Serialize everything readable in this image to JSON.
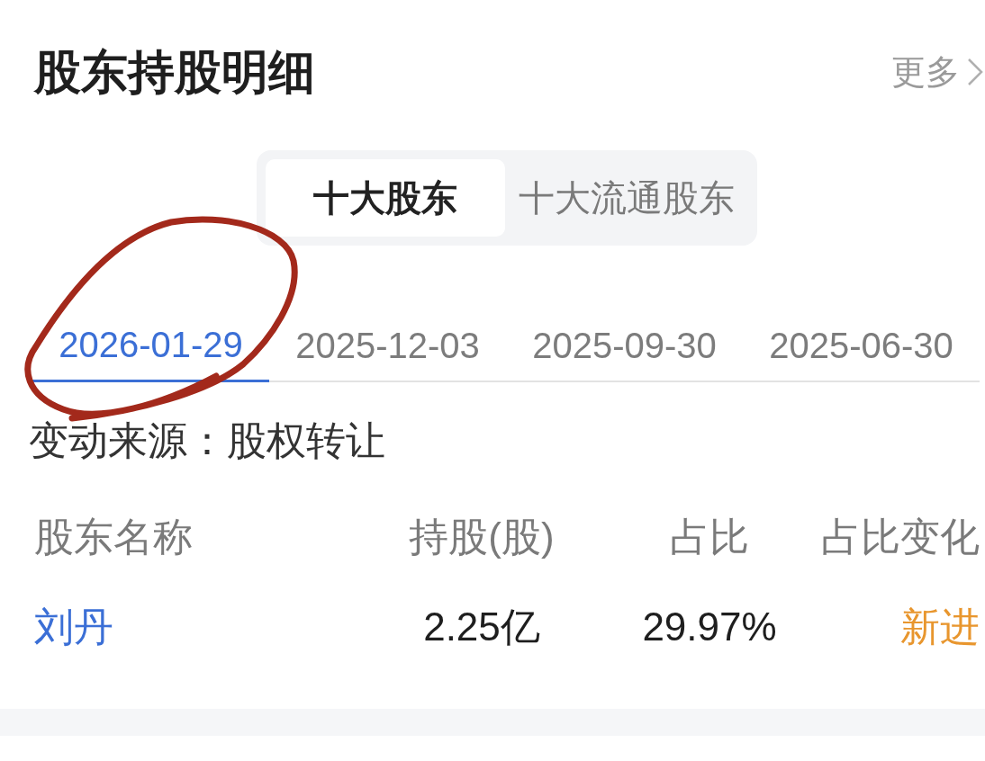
{
  "header": {
    "title": "股东持股明细",
    "more_link": "更多"
  },
  "segments": [
    {
      "label": "十大股东",
      "selected": true
    },
    {
      "label": "十大流通股东",
      "selected": false
    }
  ],
  "date_tabs": [
    {
      "label": "2026-01-29",
      "selected": true
    },
    {
      "label": "2025-12-03",
      "selected": false
    },
    {
      "label": "2025-09-30",
      "selected": false
    },
    {
      "label": "2025-06-30",
      "selected": false
    }
  ],
  "change_source": "变动来源：股权转让",
  "table": {
    "columns": [
      "股东名称",
      "持股(股)",
      "占比",
      "占比变化"
    ],
    "rows": [
      {
        "name": "刘丹",
        "shares": "2.25亿",
        "ratio": "29.97%",
        "change": "新进"
      }
    ]
  }
}
